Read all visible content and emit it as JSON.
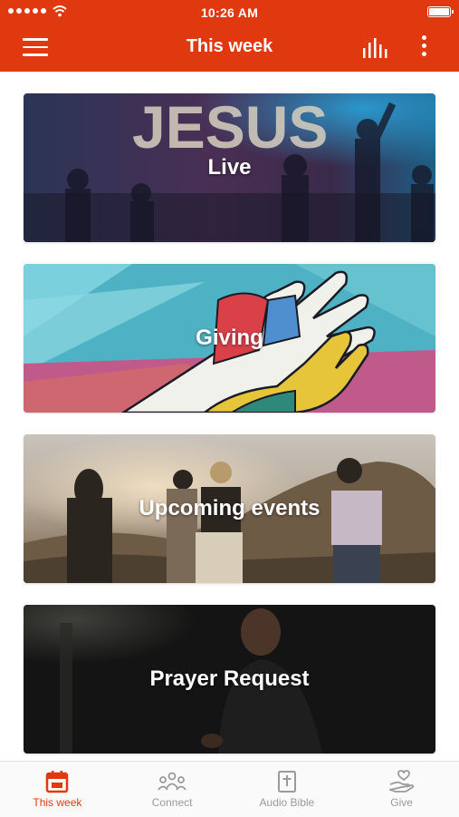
{
  "status_bar": {
    "time": "10:26 AM"
  },
  "header": {
    "title": "This week",
    "menu_icon": "hamburger-menu-icon",
    "chart_icon": "bar-chart-icon",
    "more_icon": "more-vertical-icon"
  },
  "cards": [
    {
      "label": "Live",
      "image_text": "JESUS"
    },
    {
      "label": "Giving"
    },
    {
      "label": "Upcoming events"
    },
    {
      "label": "Prayer Request"
    }
  ],
  "tabs": [
    {
      "label": "This week",
      "icon": "calendar-icon",
      "active": true
    },
    {
      "label": "Connect",
      "icon": "people-icon",
      "active": false
    },
    {
      "label": "Audio Bible",
      "icon": "bible-icon",
      "active": false
    },
    {
      "label": "Give",
      "icon": "heart-hand-icon",
      "active": false
    }
  ],
  "colors": {
    "accent": "#e0390f",
    "tab_inactive": "#9a9a9a"
  }
}
